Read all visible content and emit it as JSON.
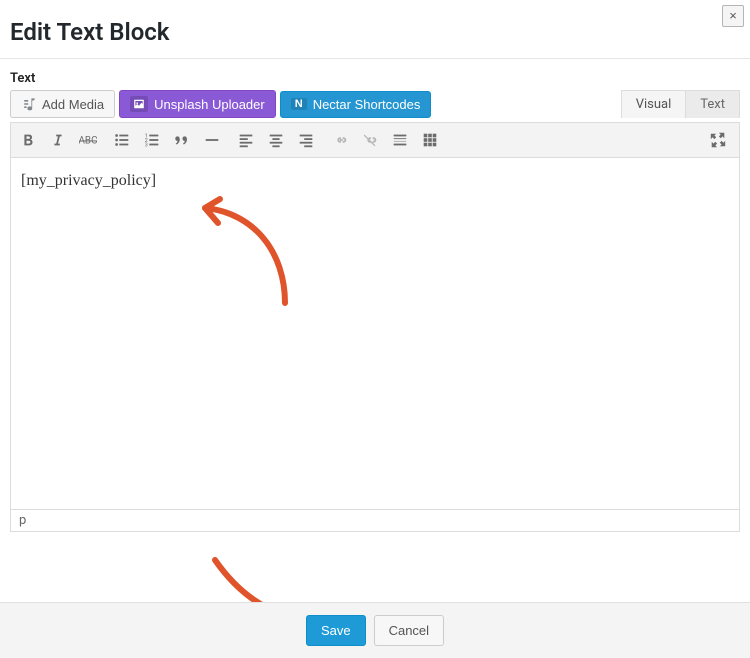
{
  "modal": {
    "title": "Edit Text Block",
    "close_label": "×"
  },
  "field_label": "Text",
  "media_buttons": {
    "add_media": "Add Media",
    "unsplash": "Unsplash Uploader",
    "nectar": "Nectar Shortcodes"
  },
  "tabs": {
    "visual": "Visual",
    "text": "Text",
    "active": "Visual"
  },
  "editor": {
    "content": "[my_privacy_policy]",
    "status_path": "p"
  },
  "footer": {
    "save": "Save",
    "cancel": "Cancel"
  }
}
